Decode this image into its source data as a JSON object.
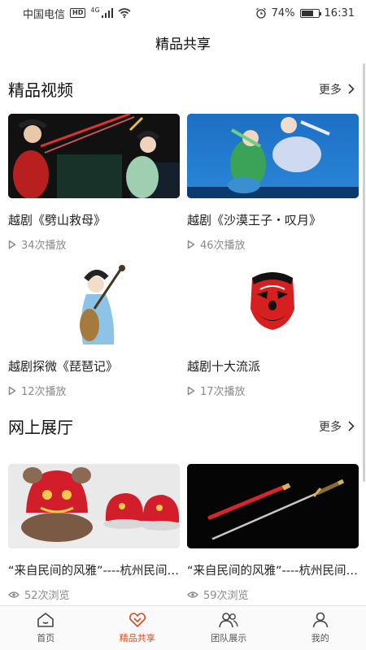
{
  "status_bar": {
    "carrier": "中国电信",
    "hd": "HD",
    "network": "4G",
    "battery_percent": "74%",
    "battery_level": 0.74,
    "time": "16:31"
  },
  "header": {
    "title": "精品共享"
  },
  "videos_section": {
    "title": "精品视频",
    "more_label": "更多",
    "items": [
      {
        "title": "越剧《劈山救母》",
        "meta": "34次播放",
        "icon": "play-icon"
      },
      {
        "title": "越剧《沙漠王子・叹月》",
        "meta": "46次播放",
        "icon": "play-icon"
      },
      {
        "title": "越剧探微《琵琶记》",
        "meta": "12次播放",
        "icon": "play-icon"
      },
      {
        "title": "越剧十大流派",
        "meta": "17次播放",
        "icon": "play-icon"
      }
    ]
  },
  "gallery_section": {
    "title": "网上展厅",
    "more_label": "更多",
    "items": [
      {
        "title": "“来自民间的风雅”----杭州民间…",
        "meta": "52次浏览",
        "icon": "eye-icon"
      },
      {
        "title": "“来自民间的风雅”----杭州民间…",
        "meta": "59次浏览",
        "icon": "eye-icon"
      }
    ]
  },
  "tab_bar": {
    "active_color": "#d9481c",
    "tabs": [
      {
        "label": "首页",
        "icon": "home-icon"
      },
      {
        "label": "精品共享",
        "icon": "share-heart-icon"
      },
      {
        "label": "团队展示",
        "icon": "team-icon"
      },
      {
        "label": "我的",
        "icon": "user-icon"
      }
    ]
  }
}
